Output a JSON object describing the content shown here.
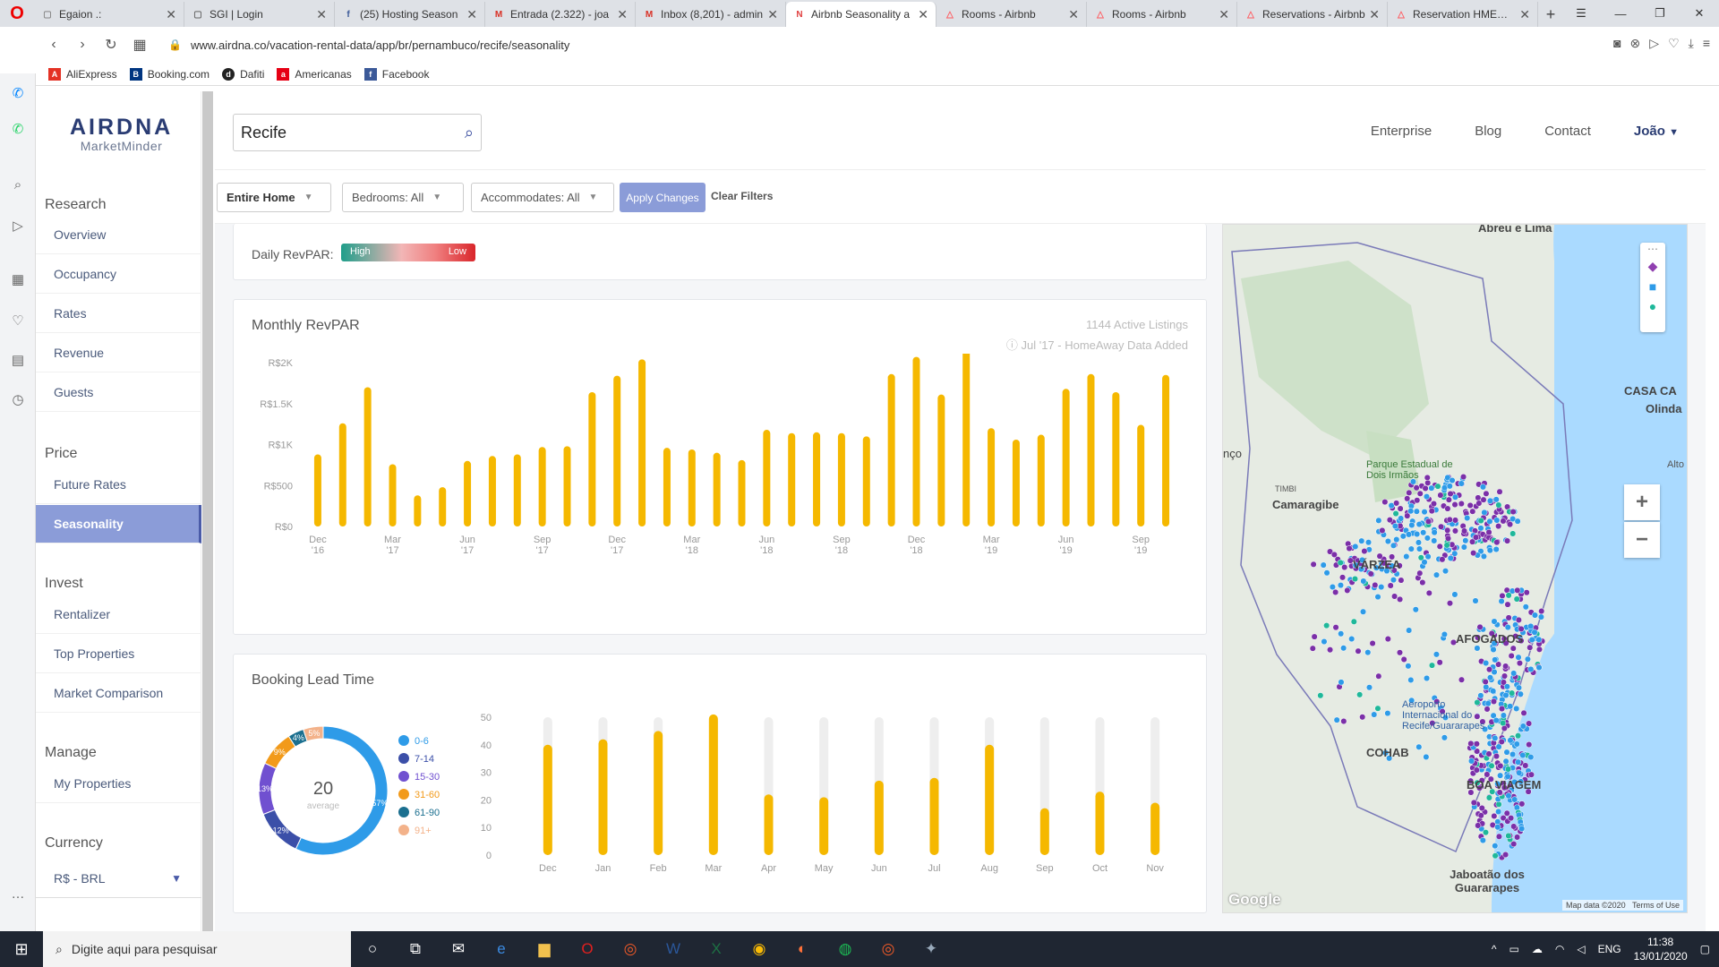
{
  "browser": {
    "tabs": [
      {
        "label": "Egaion .:",
        "active": false
      },
      {
        "label": "SGI | Login",
        "active": false
      },
      {
        "label": "(25) Hosting Season",
        "active": false
      },
      {
        "label": "Entrada (2.322) - joa",
        "active": false
      },
      {
        "label": "Inbox (8,201) - admin",
        "active": false
      },
      {
        "label": "Airbnb Seasonality a",
        "active": true
      },
      {
        "label": "Rooms - Airbnb",
        "active": false
      },
      {
        "label": "Rooms - Airbnb",
        "active": false
      },
      {
        "label": "Reservations - Airbnb",
        "active": false
      },
      {
        "label": "Reservation HMEWW",
        "active": false
      }
    ],
    "url": "www.airdna.co/vacation-rental-data/app/br/pernambuco/recife/seasonality",
    "bookmarks": [
      "AliExpress",
      "Booking.com",
      "Dafiti",
      "Americanas",
      "Facebook"
    ]
  },
  "sidebar": {
    "logo_main": "AIRDNA",
    "logo_sub": "MarketMinder",
    "sections": {
      "research": "Research",
      "price": "Price",
      "invest": "Invest",
      "manage": "Manage",
      "currency": "Currency"
    },
    "items": {
      "overview": "Overview",
      "occupancy": "Occupancy",
      "rates": "Rates",
      "revenue": "Revenue",
      "guests": "Guests",
      "future_rates": "Future Rates",
      "seasonality": "Seasonality",
      "rentalizer": "Rentalizer",
      "top_properties": "Top Properties",
      "market_comparison": "Market Comparison",
      "my_properties": "My Properties"
    },
    "currency_value": "R$ - BRL"
  },
  "header": {
    "search_value": "Recife",
    "nav": {
      "enterprise": "Enterprise",
      "blog": "Blog",
      "contact": "Contact",
      "user": "João"
    }
  },
  "filters": {
    "home_type": "Entire Home",
    "bedrooms": "Bedrooms: All",
    "accommodates": "Accommodates: All",
    "apply": "Apply Changes",
    "clear": "Clear Filters"
  },
  "legend": {
    "label": "Daily RevPAR:",
    "high": "High",
    "low": "Low"
  },
  "chart_data": [
    {
      "type": "bar",
      "title": "Monthly RevPAR",
      "subtitle_1": "1144 Active Listings",
      "subtitle_2": "Jul '17 - HomeAway Data Added",
      "yticks": [
        "R$0",
        "R$500",
        "R$1K",
        "R$1.5K",
        "R$2K"
      ],
      "ylim": [
        0,
        2000
      ],
      "xticks": [
        {
          "idx": 0,
          "m": "Dec",
          "y": "'16"
        },
        {
          "idx": 3,
          "m": "Mar",
          "y": "'17"
        },
        {
          "idx": 6,
          "m": "Jun",
          "y": "'17"
        },
        {
          "idx": 9,
          "m": "Sep",
          "y": "'17"
        },
        {
          "idx": 12,
          "m": "Dec",
          "y": "'17"
        },
        {
          "idx": 15,
          "m": "Mar",
          "y": "'18"
        },
        {
          "idx": 18,
          "m": "Jun",
          "y": "'18"
        },
        {
          "idx": 21,
          "m": "Sep",
          "y": "'18"
        },
        {
          "idx": 24,
          "m": "Dec",
          "y": "'18"
        },
        {
          "idx": 27,
          "m": "Mar",
          "y": "'19"
        },
        {
          "idx": 30,
          "m": "Jun",
          "y": "'19"
        },
        {
          "idx": 33,
          "m": "Sep",
          "y": "'19"
        }
      ],
      "values": [
        880,
        1260,
        1700,
        760,
        380,
        480,
        800,
        860,
        880,
        970,
        980,
        1640,
        1840,
        2040,
        960,
        940,
        900,
        810,
        1180,
        1140,
        1150,
        1140,
        1100,
        1860,
        2070,
        1610,
        2350,
        1200,
        1060,
        1120,
        1680,
        1860,
        1640,
        1240,
        1850
      ],
      "color": "#f5b800"
    },
    {
      "type": "pie",
      "title": "Booking Lead Time",
      "center_value": "20",
      "center_label": "average",
      "legend": [
        "0-6",
        "7-14",
        "15-30",
        "31-60",
        "61-90",
        "91+"
      ],
      "values": [
        57,
        12,
        13,
        9,
        4,
        5
      ],
      "colors": [
        "#2e9be8",
        "#3b4fa8",
        "#7050d0",
        "#f29a1a",
        "#1b6f8f",
        "#f3b28a"
      ],
      "slice_labels": [
        "57%",
        "12%",
        "13%",
        "9%",
        "4%",
        "5%"
      ]
    },
    {
      "type": "bar",
      "categories": [
        "Dec",
        "Jan",
        "Feb",
        "Mar",
        "Apr",
        "May",
        "Jun",
        "Jul",
        "Aug",
        "Sep",
        "Oct",
        "Nov"
      ],
      "values": [
        40,
        42,
        45,
        51,
        22,
        21,
        27,
        28,
        40,
        17,
        23,
        19
      ],
      "yticks": [
        0,
        10,
        20,
        30,
        40,
        50
      ],
      "ylim": [
        0,
        50
      ],
      "color": "#f5b800"
    }
  ],
  "map": {
    "labels": [
      "Abreu e Lima",
      "CASA CA",
      "Olinda",
      "Parque Estadual de Dois Irmãos",
      "Camaragibe",
      "VÁRZEA",
      "AFOGADOS",
      "Aeroporto Internacional do Recife/Guararapes",
      "COHAB",
      "BOA VIAGEM",
      "Jaboatão dos Guararapes",
      "TIMBI",
      "Alto d",
      "nço"
    ],
    "footer": [
      "Map data ©2020",
      "Terms of Use"
    ],
    "google": "Google"
  },
  "taskbar": {
    "search_placeholder": "Digite aqui para pesquisar",
    "lang": "ENG",
    "time": "11:38",
    "date": "13/01/2020"
  }
}
